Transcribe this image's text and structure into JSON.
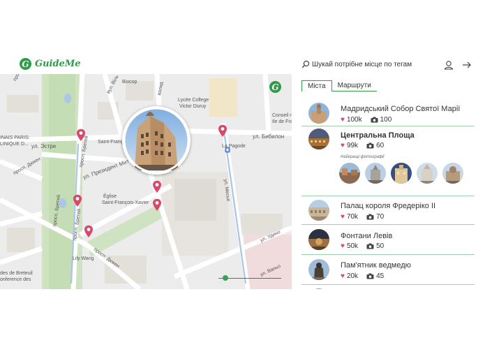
{
  "app": {
    "name": "GuideMe",
    "logo_letter": "G"
  },
  "search": {
    "placeholder": "Шукай потрібне місце по тегам"
  },
  "icons": {
    "search": "search-icon",
    "user": "user-icon",
    "logout": "arrow-right-icon",
    "heart": "heart-icon",
    "camera": "camera-icon",
    "pin": "map-pin-icon"
  },
  "colors": {
    "accent": "#2f9a48",
    "pin": "#d9486a",
    "divider": "#9fd0a9"
  },
  "tabs": [
    {
      "label": "Міста",
      "active": true
    },
    {
      "label": "Маршрути",
      "active": false
    }
  ],
  "places": [
    {
      "title": "Мадридський Собор Святої Марії",
      "likes": "100k",
      "photos": "100"
    },
    {
      "title": "Центральна Площа",
      "likes": "99k",
      "photos": "60"
    },
    {
      "title": "Палац короля Фредеріко ІІ",
      "likes": "70k",
      "photos": "70"
    },
    {
      "title": "Фонтани Левів",
      "likes": "50k",
      "photos": "50"
    },
    {
      "title": "Пам'ятник ведмедю",
      "likes": "20k",
      "photos": "45"
    }
  ],
  "best_photos_label": "Найкращі фотографії",
  "map": {
    "labels": {
      "prosp_seryur": "просп. Серюр",
      "vil": "вул. Віль",
      "biocop": "Biocop",
      "valid": "валид",
      "lycee1": "Lycée College",
      "lycee2": "Victor Duruy",
      "consell1": "Conseil r",
      "consell2": "Ile de Fra",
      "paris1": "INAIS PARIS:",
      "paris2": "LINIQUE D...",
      "estre": "ул. Эстре",
      "saint_francois": "Saint-François",
      "prosp_breteil_top": "просп. Бретей",
      "la_pagode": "La Pagode",
      "bibilon": "ул. Бибилон",
      "prezident": "ул. Президент Митт",
      "dyuken1": "просп. Дюкен",
      "eglise1": "Église",
      "eglise2": "Saint-François-Xavier",
      "mesyu": "ул. Месье",
      "prosp_breteil_left": "просп. Бретей",
      "prosp_breteil_mid": "просп. Бретей",
      "breteil_bottom1": "des de Breteuil",
      "breteil_bottom2": "onference des",
      "lily": "Lily Wang",
      "dyuken2": "просп. Дюкен",
      "udino": "ул. Удино",
      "vanyo": "ул. Ваньо"
    }
  }
}
